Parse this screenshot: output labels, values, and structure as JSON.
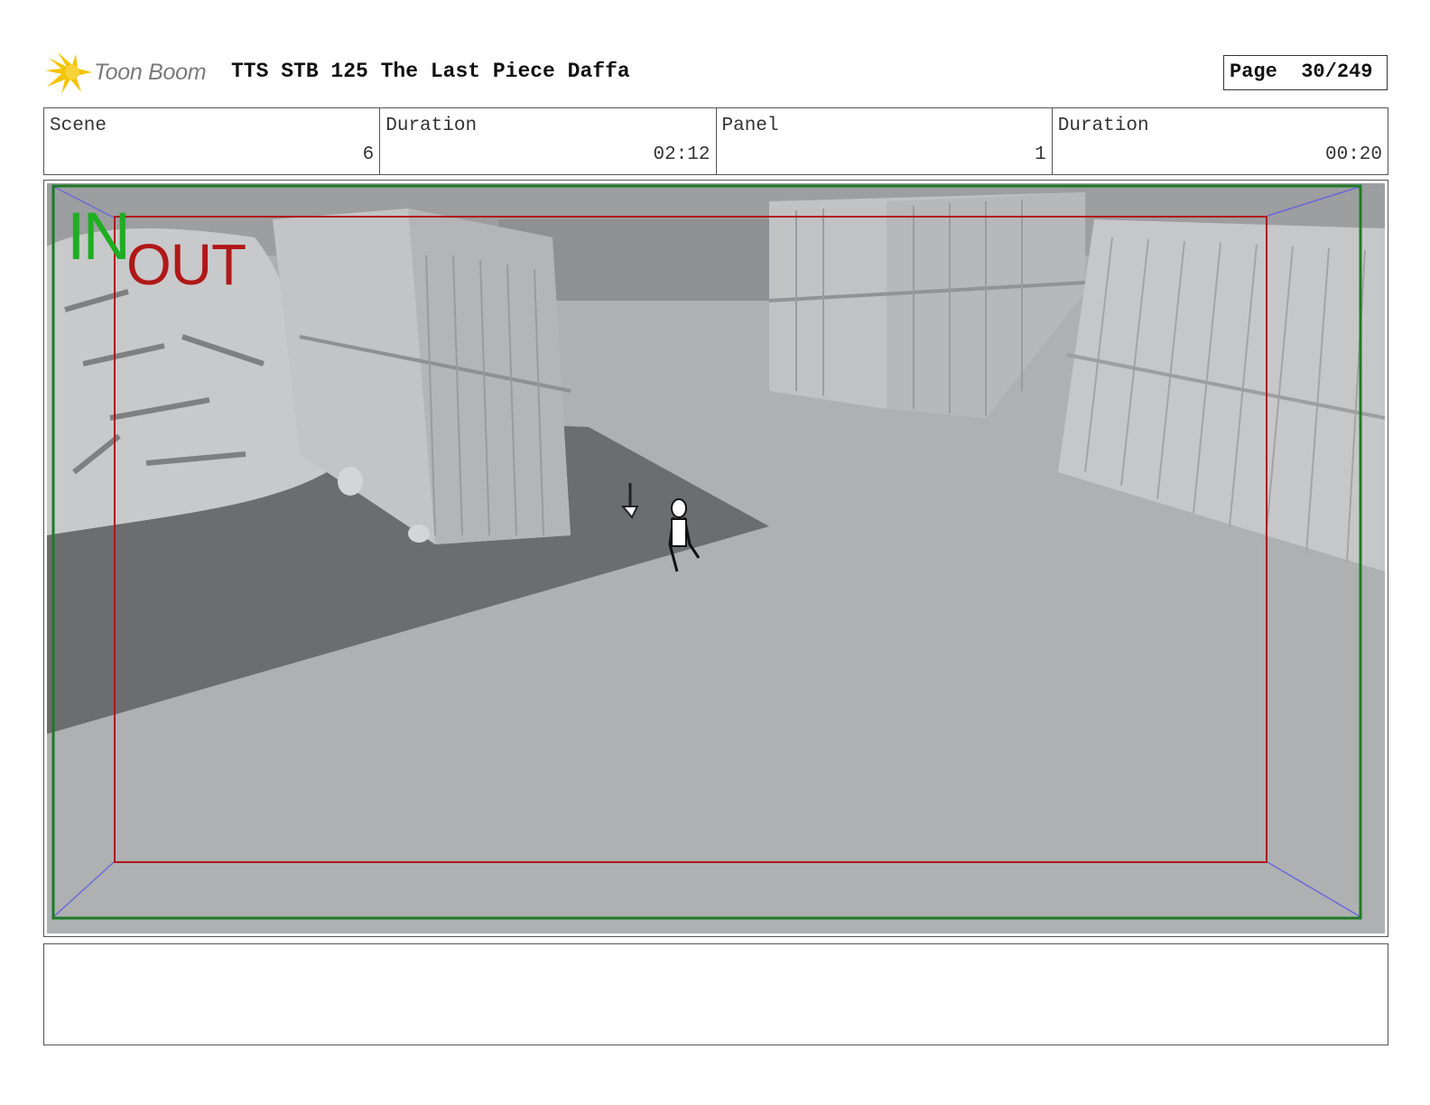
{
  "header": {
    "logo_text": "Toon Boom",
    "title": "TTS STB 125 The Last Piece Daffa",
    "page": "Page  30/249"
  },
  "info": {
    "scene_label": "Scene",
    "scene_value": "6",
    "scene_duration_label": "Duration",
    "scene_duration_value": "02:12",
    "panel_label": "Panel",
    "panel_value": "1",
    "panel_duration_label": "Duration",
    "panel_duration_value": "00:20"
  },
  "panel": {
    "in_label": "IN",
    "out_label": "OUT",
    "in_frame_color": "#1e7a26",
    "out_frame_color": "#b01818",
    "camera_path_color": "#6a6ad8"
  },
  "notes": {
    "text": ""
  }
}
